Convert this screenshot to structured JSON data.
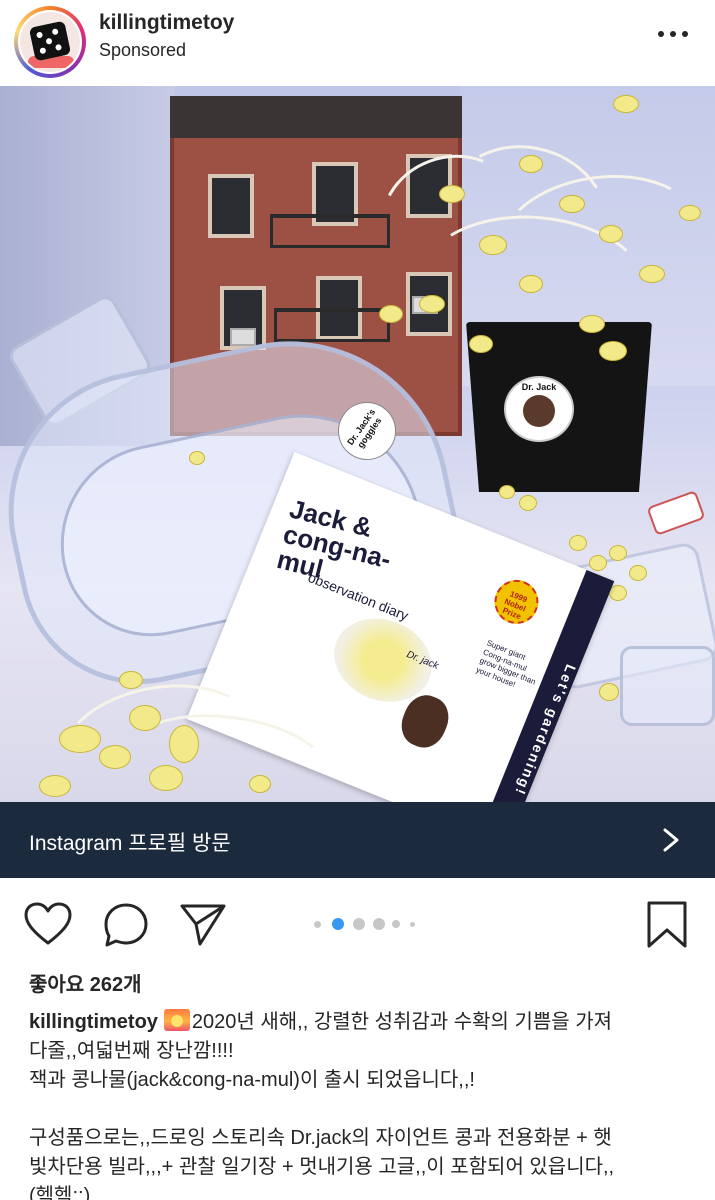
{
  "post": {
    "username": "killingtimetoy",
    "sponsored_label": "Sponsored"
  },
  "photo": {
    "pot_label": "Dr. Jack",
    "goggles_tag": "Dr. Jack's goggles",
    "booklet": {
      "title": "Jack & cong-na-mul",
      "subtitle": "observation diary",
      "seal": "1999 Nobel Prize",
      "side_text": "Let's gardening!",
      "author": "Dr. jack",
      "note": "Super giant Cong-na-mul grow bigger than your house!"
    }
  },
  "profile_bar": {
    "label": "Instagram 프로필 방문"
  },
  "actions": {
    "carousel": {
      "count": 6,
      "active_index": 1
    },
    "likes_text": "좋아요 262개"
  },
  "caption": {
    "username": "killingtimetoy",
    "emoji": "sunrise-emoji",
    "line1_text": "2020년 새해,, 강렬한 성취감과 수확의 기쁨을 가져",
    "line2": "다줄,,여덟번째 장난깜!!!!",
    "line3": "잭과 콩나물(jack&cong-na-mul)이 출시 되었읍니다,,!",
    "line4": "구성품으로는,,드로잉 스토리속 Dr.jack의 자이언트 콩과 전용화분 + 햇",
    "line5": "빛차단용 빌라,,,+ 관찰 일기장 + 멋내기용 고글,,이 포함되어 있읍니다,,",
    "line6": "(헥헥;;)"
  },
  "colors": {
    "profile_bar_bg": "#1b2a3c",
    "active_dot": "#3897f0",
    "inactive_dot": "#c7c7c7",
    "text": "#262626"
  }
}
